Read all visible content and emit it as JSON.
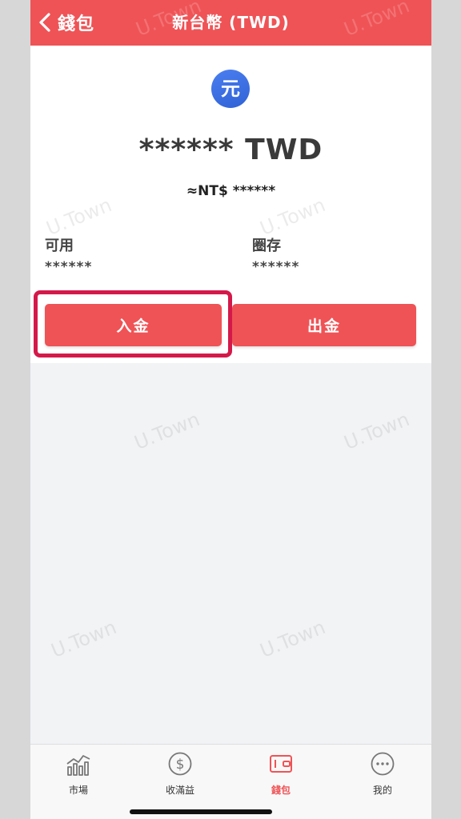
{
  "navbar": {
    "back_label": "錢包",
    "title": "新台幣 (TWD)"
  },
  "currency": {
    "icon_char": "元",
    "icon_name": "yuan-coin-icon"
  },
  "balance": {
    "amount": "****** TWD",
    "approx": "≈NT$ ******"
  },
  "stats": [
    {
      "label": "可用",
      "value": "******"
    },
    {
      "label": "圈存",
      "value": "******"
    }
  ],
  "actions": {
    "deposit_label": "入金",
    "withdraw_label": "出金"
  },
  "watermark_text": "U.Town",
  "tabs": [
    {
      "label": "市場",
      "icon": "market-chart-icon",
      "active": false
    },
    {
      "label": "收滿益",
      "icon": "dollar-circle-icon",
      "active": false
    },
    {
      "label": "錢包",
      "icon": "wallet-icon",
      "active": true
    },
    {
      "label": "我的",
      "icon": "more-circle-icon",
      "active": false
    }
  ],
  "colors": {
    "accent": "#ef5356",
    "highlight": "#d4194a",
    "coin": "#3b6fe2"
  }
}
